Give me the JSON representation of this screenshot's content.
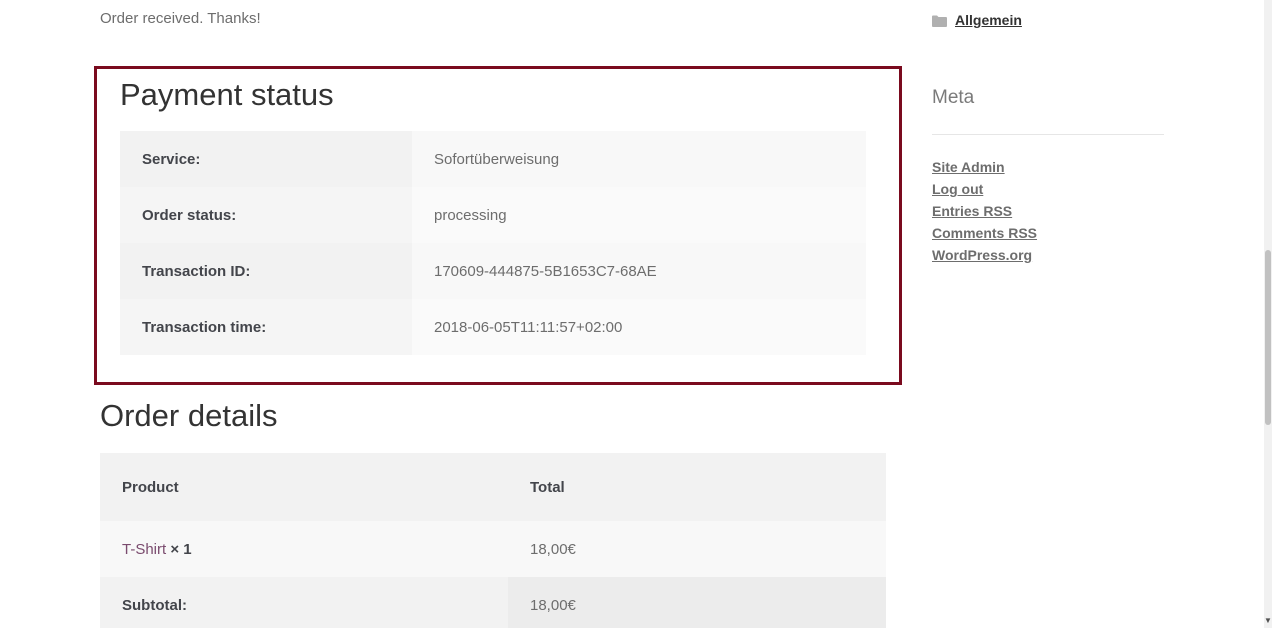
{
  "notice": "Order received. Thanks!",
  "payment_status": {
    "title": "Payment status",
    "rows": [
      {
        "label": "Service:",
        "value": "Sofortüberweisung"
      },
      {
        "label": "Order status:",
        "value": "processing"
      },
      {
        "label": "Transaction ID:",
        "value": "170609-444875-5B1653C7-68AE"
      },
      {
        "label": "Transaction time:",
        "value": "2018-06-05T11:11:57+02:00"
      }
    ],
    "border_color": "#7a0a1e"
  },
  "order_details": {
    "title": "Order details",
    "columns": [
      "Product",
      "Total"
    ],
    "items": [
      {
        "product": "T-Shirt",
        "quantity": "× 1",
        "total": "18,00€"
      }
    ],
    "subtotal_label": "Subtotal:",
    "subtotal_value": "18,00€"
  },
  "sidebar": {
    "category": {
      "icon": "folder-icon",
      "label": "Allgemein"
    },
    "meta": {
      "title": "Meta",
      "links": [
        "Site Admin",
        "Log out",
        "Entries RSS",
        "Comments RSS",
        "WordPress.org"
      ]
    }
  }
}
